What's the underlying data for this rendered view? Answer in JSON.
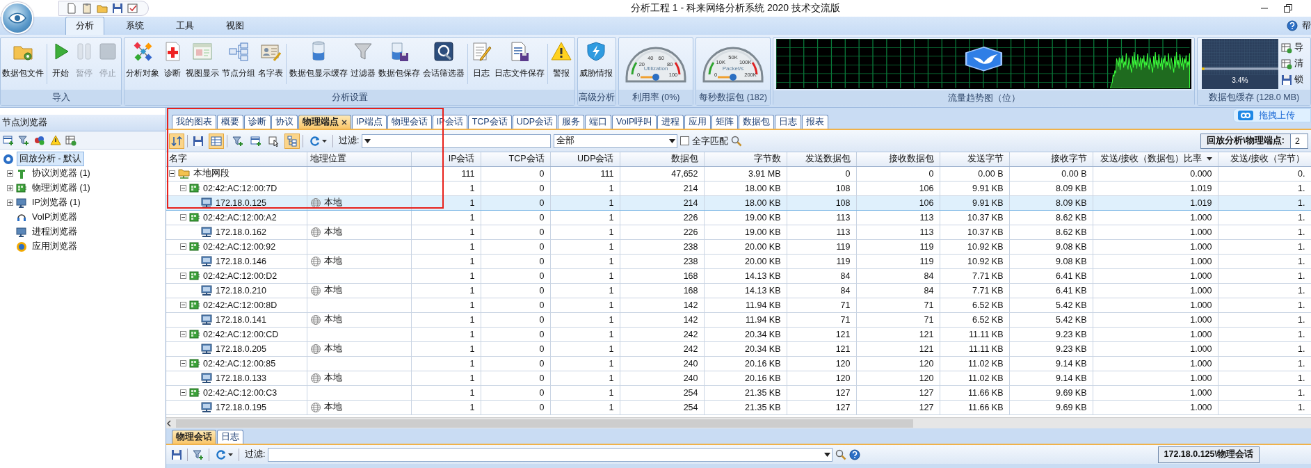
{
  "window": {
    "title": "分析工程 1 - 科来网络分析系统 2020 技术交流版"
  },
  "ribbon": {
    "tabs": [
      {
        "label": "分析",
        "selected": true
      },
      {
        "label": "系统",
        "selected": false
      },
      {
        "label": "工具",
        "selected": false
      },
      {
        "label": "视图",
        "selected": false
      }
    ],
    "help_label": "帮",
    "groups": [
      {
        "label": "导入",
        "buttons": [
          {
            "label": "数据包文件",
            "disabled": false
          },
          {
            "label": "开始",
            "disabled": false
          },
          {
            "label": "暂停",
            "disabled": true
          },
          {
            "label": "停止",
            "disabled": true
          }
        ]
      },
      {
        "label": "分析设置",
        "buttons": [
          {
            "label": "分析对象",
            "disabled": false
          },
          {
            "label": "诊断",
            "disabled": false
          },
          {
            "label": "视图显示",
            "disabled": false
          },
          {
            "label": "节点分组",
            "disabled": false
          },
          {
            "label": "名字表",
            "disabled": false
          },
          {
            "label": "数据包显示缓存",
            "disabled": false
          },
          {
            "label": "过滤器",
            "disabled": false
          },
          {
            "label": "数据包保存",
            "disabled": false
          },
          {
            "label": "会话筛选器",
            "disabled": false
          },
          {
            "label": "日志",
            "disabled": false
          },
          {
            "label": "日志文件保存",
            "disabled": false
          },
          {
            "label": "警报",
            "disabled": false
          }
        ]
      },
      {
        "label": "高级分析",
        "buttons": [
          {
            "label": "威胁情报",
            "disabled": false
          }
        ]
      }
    ],
    "gauges": [
      {
        "caption": "利用率 (0%)",
        "title": "Utilization",
        "ticks": [
          "0",
          "20",
          "40",
          "60",
          "80",
          "100"
        ]
      },
      {
        "caption": "每秒数据包 (182)",
        "title": "Packet/s",
        "ticks": [
          "0",
          "10K",
          "50K",
          "100K",
          "200K"
        ]
      }
    ],
    "trend": {
      "caption": "流量趋势图（位）"
    },
    "buffer": {
      "caption": "数据包缓存 (128.0 MB)",
      "reading": "3.4%",
      "level": 0.034,
      "actions": [
        "导",
        "清",
        "锁"
      ]
    }
  },
  "upload_button": "拖拽上传",
  "node_browser": {
    "title": "节点浏览器",
    "tree": [
      {
        "label": "回放分析 - 默认",
        "kind": "root",
        "selected": true,
        "children": [
          {
            "label": "协议浏览器 (1)",
            "kind": "protocol",
            "selected": false,
            "expanded": false
          },
          {
            "label": "物理浏览器 (1)",
            "kind": "physical",
            "selected": false,
            "expanded": false
          },
          {
            "label": "IP浏览器 (1)",
            "kind": "ip",
            "selected": false,
            "expanded": false
          },
          {
            "label": "VoIP浏览器",
            "kind": "voip",
            "selected": false
          },
          {
            "label": "进程浏览器",
            "kind": "process",
            "selected": false
          },
          {
            "label": "应用浏览器",
            "kind": "app",
            "selected": false
          }
        ]
      }
    ]
  },
  "view_tabs": [
    {
      "label": "我的图表",
      "selected": false
    },
    {
      "label": "概要",
      "selected": false
    },
    {
      "label": "诊断",
      "selected": false
    },
    {
      "label": "协议",
      "selected": false
    },
    {
      "label": "物理端点",
      "selected": true
    },
    {
      "label": "IP端点",
      "selected": false
    },
    {
      "label": "物理会话",
      "selected": false
    },
    {
      "label": "IP会话",
      "selected": false
    },
    {
      "label": "TCP会话",
      "selected": false
    },
    {
      "label": "UDP会话",
      "selected": false
    },
    {
      "label": "服务",
      "selected": false
    },
    {
      "label": "端口",
      "selected": false
    },
    {
      "label": "VoIP呼叫",
      "selected": false
    },
    {
      "label": "进程",
      "selected": false
    },
    {
      "label": "应用",
      "selected": false
    },
    {
      "label": "矩阵",
      "selected": false
    },
    {
      "label": "数据包",
      "selected": false
    },
    {
      "label": "日志",
      "selected": false
    },
    {
      "label": "报表",
      "selected": false
    }
  ],
  "toolbar": {
    "buttons": [
      {
        "on": true
      },
      {
        "on": false
      },
      {
        "on": true
      },
      {
        "on": false
      },
      {
        "on": false
      },
      {
        "on": false
      },
      {
        "on": true
      }
    ],
    "filter_label": "过滤:",
    "scope": "全部",
    "whole_word": {
      "label": "全字匹配",
      "checked": false
    },
    "path_label": "回放分析\\物理端点:",
    "path_value": "2"
  },
  "table": {
    "columns": [
      {
        "label": "名字",
        "sorted": false
      },
      {
        "label": "地理位置",
        "sorted": false
      },
      {
        "label": "IP会话",
        "sorted": false
      },
      {
        "label": "TCP会话",
        "sorted": false
      },
      {
        "label": "UDP会话",
        "sorted": false
      },
      {
        "label": "数据包",
        "sorted": false
      },
      {
        "label": "字节数",
        "sorted": false
      },
      {
        "label": "发送数据包",
        "sorted": false
      },
      {
        "label": "接收数据包",
        "sorted": false
      },
      {
        "label": "发送字节",
        "sorted": false
      },
      {
        "label": "接收字节",
        "sorted": false
      },
      {
        "label": "发送/接收（数据包）比率",
        "sorted": true
      },
      {
        "label": "发送/接收（字节）",
        "sorted": false
      }
    ],
    "rows": [
      {
        "kind": "segment",
        "expanded": true,
        "selected": false,
        "cells": [
          "本地网段",
          "",
          "111",
          "0",
          "111",
          "47,652",
          "3.91 MB",
          "0",
          "0",
          "0.00 B",
          "0.00 B",
          "0.000",
          "0."
        ],
        "children": [
          {
            "kind": "mac",
            "expanded": true,
            "selected": false,
            "cells": [
              "02:42:AC:12:00:7D",
              "",
              "1",
              "0",
              "1",
              "214",
              "18.00 KB",
              "108",
              "106",
              "9.91 KB",
              "8.09 KB",
              "1.019",
              "1."
            ],
            "children": [
              {
                "kind": "ip",
                "selected": true,
                "cells": [
                  "172.18.0.125",
                  "本地",
                  "1",
                  "0",
                  "1",
                  "214",
                  "18.00 KB",
                  "108",
                  "106",
                  "9.91 KB",
                  "8.09 KB",
                  "1.019",
                  "1."
                ]
              }
            ]
          },
          {
            "kind": "mac",
            "expanded": true,
            "selected": false,
            "cells": [
              "02:42:AC:12:00:A2",
              "",
              "1",
              "0",
              "1",
              "226",
              "19.00 KB",
              "113",
              "113",
              "10.37 KB",
              "8.62 KB",
              "1.000",
              "1."
            ],
            "children": [
              {
                "kind": "ip",
                "selected": false,
                "cells": [
                  "172.18.0.162",
                  "本地",
                  "1",
                  "0",
                  "1",
                  "226",
                  "19.00 KB",
                  "113",
                  "113",
                  "10.37 KB",
                  "8.62 KB",
                  "1.000",
                  "1."
                ]
              }
            ]
          },
          {
            "kind": "mac",
            "expanded": true,
            "selected": false,
            "cells": [
              "02:42:AC:12:00:92",
              "",
              "1",
              "0",
              "1",
              "238",
              "20.00 KB",
              "119",
              "119",
              "10.92 KB",
              "9.08 KB",
              "1.000",
              "1."
            ],
            "children": [
              {
                "kind": "ip",
                "selected": false,
                "cells": [
                  "172.18.0.146",
                  "本地",
                  "1",
                  "0",
                  "1",
                  "238",
                  "20.00 KB",
                  "119",
                  "119",
                  "10.92 KB",
                  "9.08 KB",
                  "1.000",
                  "1."
                ]
              }
            ]
          },
          {
            "kind": "mac",
            "expanded": true,
            "selected": false,
            "cells": [
              "02:42:AC:12:00:D2",
              "",
              "1",
              "0",
              "1",
              "168",
              "14.13 KB",
              "84",
              "84",
              "7.71 KB",
              "6.41 KB",
              "1.000",
              "1."
            ],
            "children": [
              {
                "kind": "ip",
                "selected": false,
                "cells": [
                  "172.18.0.210",
                  "本地",
                  "1",
                  "0",
                  "1",
                  "168",
                  "14.13 KB",
                  "84",
                  "84",
                  "7.71 KB",
                  "6.41 KB",
                  "1.000",
                  "1."
                ]
              }
            ]
          },
          {
            "kind": "mac",
            "expanded": true,
            "selected": false,
            "cells": [
              "02:42:AC:12:00:8D",
              "",
              "1",
              "0",
              "1",
              "142",
              "11.94 KB",
              "71",
              "71",
              "6.52 KB",
              "5.42 KB",
              "1.000",
              "1."
            ],
            "children": [
              {
                "kind": "ip",
                "selected": false,
                "cells": [
                  "172.18.0.141",
                  "本地",
                  "1",
                  "0",
                  "1",
                  "142",
                  "11.94 KB",
                  "71",
                  "71",
                  "6.52 KB",
                  "5.42 KB",
                  "1.000",
                  "1."
                ]
              }
            ]
          },
          {
            "kind": "mac",
            "expanded": true,
            "selected": false,
            "cells": [
              "02:42:AC:12:00:CD",
              "",
              "1",
              "0",
              "1",
              "242",
              "20.34 KB",
              "121",
              "121",
              "11.11 KB",
              "9.23 KB",
              "1.000",
              "1."
            ],
            "children": [
              {
                "kind": "ip",
                "selected": false,
                "cells": [
                  "172.18.0.205",
                  "本地",
                  "1",
                  "0",
                  "1",
                  "242",
                  "20.34 KB",
                  "121",
                  "121",
                  "11.11 KB",
                  "9.23 KB",
                  "1.000",
                  "1."
                ]
              }
            ]
          },
          {
            "kind": "mac",
            "expanded": true,
            "selected": false,
            "cells": [
              "02:42:AC:12:00:85",
              "",
              "1",
              "0",
              "1",
              "240",
              "20.16 KB",
              "120",
              "120",
              "11.02 KB",
              "9.14 KB",
              "1.000",
              "1."
            ],
            "children": [
              {
                "kind": "ip",
                "selected": false,
                "cells": [
                  "172.18.0.133",
                  "本地",
                  "1",
                  "0",
                  "1",
                  "240",
                  "20.16 KB",
                  "120",
                  "120",
                  "11.02 KB",
                  "9.14 KB",
                  "1.000",
                  "1."
                ]
              }
            ]
          },
          {
            "kind": "mac",
            "expanded": true,
            "selected": false,
            "cells": [
              "02:42:AC:12:00:C3",
              "",
              "1",
              "0",
              "1",
              "254",
              "21.35 KB",
              "127",
              "127",
              "11.66 KB",
              "9.69 KB",
              "1.000",
              "1."
            ],
            "children": [
              {
                "kind": "ip",
                "selected": false,
                "cells": [
                  "172.18.0.195",
                  "本地",
                  "1",
                  "0",
                  "1",
                  "254",
                  "21.35 KB",
                  "127",
                  "127",
                  "11.66 KB",
                  "9.69 KB",
                  "1.000",
                  "1."
                ]
              }
            ]
          }
        ]
      }
    ]
  },
  "bottom": {
    "tabs": [
      {
        "label": "物理会话",
        "selected": true
      },
      {
        "label": "日志",
        "selected": false
      }
    ],
    "filter_label": "过滤:",
    "status": "172.18.0.125\\物理会话"
  }
}
